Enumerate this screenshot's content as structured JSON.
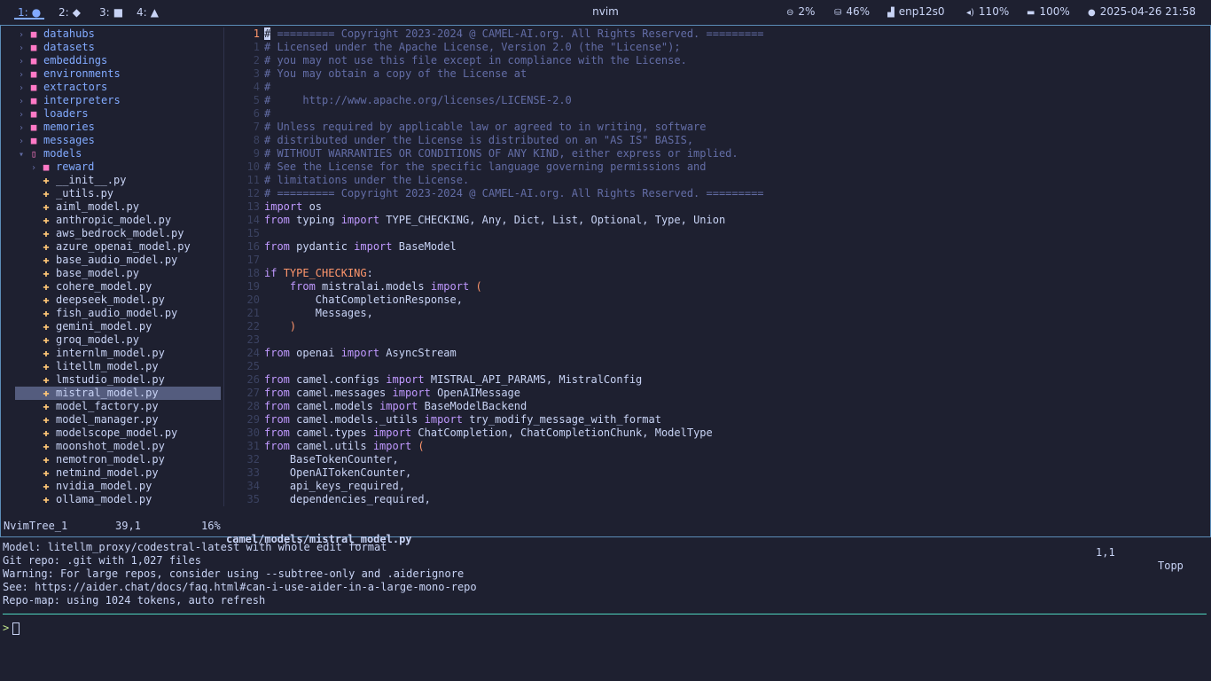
{
  "topbar": {
    "workspaces": [
      {
        "num": "1:",
        "icon": "●",
        "active": true
      },
      {
        "num": "2:",
        "icon": "◆",
        "active": false
      },
      {
        "num": "3:",
        "icon": "■",
        "active": false
      },
      {
        "num": "4:",
        "icon": "▲",
        "active": false
      }
    ],
    "title": "nvim",
    "cpu": "2%",
    "mem": "46%",
    "network": "enp12s0",
    "volume": "110%",
    "battery": "100%",
    "datetime": "2025-04-26 21:58"
  },
  "tree": {
    "items": [
      {
        "name": "datahubs",
        "type": "dir",
        "depth": 0
      },
      {
        "name": "datasets",
        "type": "dir",
        "depth": 0
      },
      {
        "name": "embeddings",
        "type": "dir",
        "depth": 0
      },
      {
        "name": "environments",
        "type": "dir",
        "depth": 0
      },
      {
        "name": "extractors",
        "type": "dir",
        "depth": 0
      },
      {
        "name": "interpreters",
        "type": "dir",
        "depth": 0
      },
      {
        "name": "loaders",
        "type": "dir",
        "depth": 0
      },
      {
        "name": "memories",
        "type": "dir",
        "depth": 0
      },
      {
        "name": "messages",
        "type": "dir",
        "depth": 0
      },
      {
        "name": "models",
        "type": "diropen",
        "depth": 0
      },
      {
        "name": "reward",
        "type": "dir",
        "depth": 1
      },
      {
        "name": "__init__.py",
        "type": "py",
        "depth": 1
      },
      {
        "name": "_utils.py",
        "type": "py",
        "depth": 1
      },
      {
        "name": "aiml_model.py",
        "type": "py",
        "depth": 1
      },
      {
        "name": "anthropic_model.py",
        "type": "py",
        "depth": 1
      },
      {
        "name": "aws_bedrock_model.py",
        "type": "py",
        "depth": 1
      },
      {
        "name": "azure_openai_model.py",
        "type": "py",
        "depth": 1
      },
      {
        "name": "base_audio_model.py",
        "type": "py",
        "depth": 1
      },
      {
        "name": "base_model.py",
        "type": "py",
        "depth": 1
      },
      {
        "name": "cohere_model.py",
        "type": "py",
        "depth": 1
      },
      {
        "name": "deepseek_model.py",
        "type": "py",
        "depth": 1
      },
      {
        "name": "fish_audio_model.py",
        "type": "py",
        "depth": 1
      },
      {
        "name": "gemini_model.py",
        "type": "py",
        "depth": 1
      },
      {
        "name": "groq_model.py",
        "type": "py",
        "depth": 1
      },
      {
        "name": "internlm_model.py",
        "type": "py",
        "depth": 1
      },
      {
        "name": "litellm_model.py",
        "type": "py",
        "depth": 1
      },
      {
        "name": "lmstudio_model.py",
        "type": "py",
        "depth": 1
      },
      {
        "name": "mistral_model.py",
        "type": "py",
        "depth": 1,
        "selected": true
      },
      {
        "name": "model_factory.py",
        "type": "py",
        "depth": 1
      },
      {
        "name": "model_manager.py",
        "type": "py",
        "depth": 1
      },
      {
        "name": "modelscope_model.py",
        "type": "py",
        "depth": 1
      },
      {
        "name": "moonshot_model.py",
        "type": "py",
        "depth": 1
      },
      {
        "name": "nemotron_model.py",
        "type": "py",
        "depth": 1
      },
      {
        "name": "netmind_model.py",
        "type": "py",
        "depth": 1
      },
      {
        "name": "nvidia_model.py",
        "type": "py",
        "depth": 1
      },
      {
        "name": "ollama_model.py",
        "type": "py",
        "depth": 1
      }
    ]
  },
  "code": {
    "lines": [
      {
        "n": "1",
        "cur": true,
        "parts": [
          [
            "cursor",
            "#"
          ],
          [
            "cm",
            " ========= Copyright 2023-2024 @ CAMEL-AI.org. All Rights Reserved. ========="
          ]
        ]
      },
      {
        "n": "1",
        "parts": [
          [
            "cm",
            "# Licensed under the Apache License, Version 2.0 (the \"License\");"
          ]
        ]
      },
      {
        "n": "2",
        "parts": [
          [
            "cm",
            "# you may not use this file except in compliance with the License."
          ]
        ]
      },
      {
        "n": "3",
        "parts": [
          [
            "cm",
            "# You may obtain a copy of the License at"
          ]
        ]
      },
      {
        "n": "4",
        "parts": [
          [
            "cm",
            "#"
          ]
        ]
      },
      {
        "n": "5",
        "parts": [
          [
            "cm",
            "#     http://www.apache.org/licenses/LICENSE-2.0"
          ]
        ]
      },
      {
        "n": "6",
        "parts": [
          [
            "cm",
            "#"
          ]
        ]
      },
      {
        "n": "7",
        "parts": [
          [
            "cm",
            "# Unless required by applicable law or agreed to in writing, software"
          ]
        ]
      },
      {
        "n": "8",
        "parts": [
          [
            "cm",
            "# distributed under the License is distributed on an \"AS IS\" BASIS,"
          ]
        ]
      },
      {
        "n": "9",
        "parts": [
          [
            "cm",
            "# WITHOUT WARRANTIES OR CONDITIONS OF ANY KIND, either express or implied."
          ]
        ]
      },
      {
        "n": "10",
        "parts": [
          [
            "cm",
            "# See the License for the specific language governing permissions and"
          ]
        ]
      },
      {
        "n": "11",
        "parts": [
          [
            "cm",
            "# limitations under the License."
          ]
        ]
      },
      {
        "n": "12",
        "parts": [
          [
            "cm",
            "# ========= Copyright 2023-2024 @ CAMEL-AI.org. All Rights Reserved. ========="
          ]
        ]
      },
      {
        "n": "13",
        "parts": [
          [
            "kw",
            "import"
          ],
          [
            "tx",
            " os"
          ]
        ]
      },
      {
        "n": "14",
        "parts": [
          [
            "kw",
            "from"
          ],
          [
            "tx",
            " typing "
          ],
          [
            "kw",
            "import"
          ],
          [
            "tx",
            " TYPE_CHECKING, Any, Dict, List, Optional, Type, Union"
          ]
        ]
      },
      {
        "n": "15",
        "parts": []
      },
      {
        "n": "16",
        "parts": [
          [
            "kw",
            "from"
          ],
          [
            "tx",
            " pydantic "
          ],
          [
            "kw",
            "import"
          ],
          [
            "tx",
            " BaseModel"
          ]
        ]
      },
      {
        "n": "17",
        "parts": []
      },
      {
        "n": "18",
        "parts": [
          [
            "kw",
            "if"
          ],
          [
            "tx",
            " "
          ],
          [
            "cn",
            "TYPE_CHECKING"
          ],
          [
            "tx",
            ":"
          ]
        ]
      },
      {
        "n": "19",
        "parts": [
          [
            "tx",
            "    "
          ],
          [
            "kw",
            "from"
          ],
          [
            "tx",
            " mistralai.models "
          ],
          [
            "kw",
            "import"
          ],
          [
            "cn",
            " ("
          ]
        ]
      },
      {
        "n": "20",
        "parts": [
          [
            "tx",
            "        ChatCompletionResponse,"
          ]
        ]
      },
      {
        "n": "21",
        "parts": [
          [
            "tx",
            "        Messages,"
          ]
        ]
      },
      {
        "n": "22",
        "parts": [
          [
            "cn",
            "    )"
          ]
        ]
      },
      {
        "n": "23",
        "parts": []
      },
      {
        "n": "24",
        "parts": [
          [
            "kw",
            "from"
          ],
          [
            "tx",
            " openai "
          ],
          [
            "kw",
            "import"
          ],
          [
            "tx",
            " AsyncStream"
          ]
        ]
      },
      {
        "n": "25",
        "parts": []
      },
      {
        "n": "26",
        "parts": [
          [
            "kw",
            "from"
          ],
          [
            "tx",
            " camel.configs "
          ],
          [
            "kw",
            "import"
          ],
          [
            "tx",
            " MISTRAL_API_PARAMS, MistralConfig"
          ]
        ]
      },
      {
        "n": "27",
        "parts": [
          [
            "kw",
            "from"
          ],
          [
            "tx",
            " camel.messages "
          ],
          [
            "kw",
            "import"
          ],
          [
            "tx",
            " OpenAIMessage"
          ]
        ]
      },
      {
        "n": "28",
        "parts": [
          [
            "kw",
            "from"
          ],
          [
            "tx",
            " camel.models "
          ],
          [
            "kw",
            "import"
          ],
          [
            "tx",
            " BaseModelBackend"
          ]
        ]
      },
      {
        "n": "29",
        "parts": [
          [
            "kw",
            "from"
          ],
          [
            "tx",
            " camel.models._utils "
          ],
          [
            "kw",
            "import"
          ],
          [
            "tx",
            " try_modify_message_with_format"
          ]
        ]
      },
      {
        "n": "30",
        "parts": [
          [
            "kw",
            "from"
          ],
          [
            "tx",
            " camel.types "
          ],
          [
            "kw",
            "import"
          ],
          [
            "tx",
            " ChatCompletion, ChatCompletionChunk, ModelType"
          ]
        ]
      },
      {
        "n": "31",
        "parts": [
          [
            "kw",
            "from"
          ],
          [
            "tx",
            " camel.utils "
          ],
          [
            "kw",
            "import"
          ],
          [
            "cn",
            " ("
          ]
        ]
      },
      {
        "n": "32",
        "parts": [
          [
            "tx",
            "    BaseTokenCounter,"
          ]
        ]
      },
      {
        "n": "33",
        "parts": [
          [
            "tx",
            "    OpenAITokenCounter,"
          ]
        ]
      },
      {
        "n": "34",
        "parts": [
          [
            "tx",
            "    api_keys_required,"
          ]
        ]
      },
      {
        "n": "35",
        "parts": [
          [
            "tx",
            "    dependencies_required,"
          ]
        ]
      }
    ]
  },
  "status": {
    "tree_name": "NvimTree_1",
    "tree_pos": "39,1",
    "tree_pct": "16%",
    "file": "camel/models/mistral_model.py",
    "cursor_pos": "1,1",
    "scroll": "Topp"
  },
  "aider": {
    "lines": [
      "Model: litellm_proxy/codestral-latest with whole edit format",
      "Git repo: .git with 1,027 files",
      "Warning: For large repos, consider using --subtree-only and .aiderignore",
      "See: https://aider.chat/docs/faq.html#can-i-use-aider-in-a-large-mono-repo",
      "Repo-map: using 1024 tokens, auto refresh"
    ],
    "prompt": ">"
  },
  "colors": {
    "background": "#1e2030",
    "keyword": "#c099ff",
    "comment": "#636da6",
    "constant": "#ff966c",
    "directory": "#82aaff",
    "selection": "#545c7e",
    "frame_border": "#5c8db8",
    "separator_line": "#4fd6be"
  }
}
